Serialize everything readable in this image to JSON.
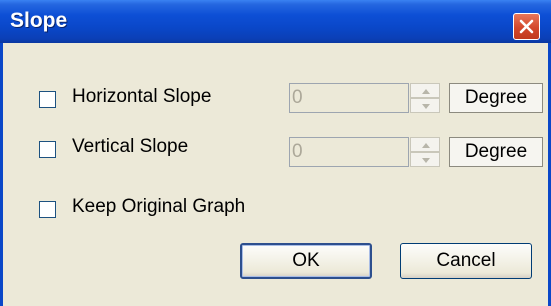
{
  "dialog": {
    "title": "Slope",
    "close_icon": "close-icon"
  },
  "options": {
    "horizontal": {
      "label": "Horizontal Slope",
      "checked": false,
      "value": "0",
      "unit": "Degree"
    },
    "vertical": {
      "label": "Vertical Slope",
      "checked": false,
      "value": "0",
      "unit": "Degree"
    },
    "keep_original": {
      "label": "Keep Original Graph",
      "checked": false
    }
  },
  "buttons": {
    "ok": "OK",
    "cancel": "Cancel"
  }
}
